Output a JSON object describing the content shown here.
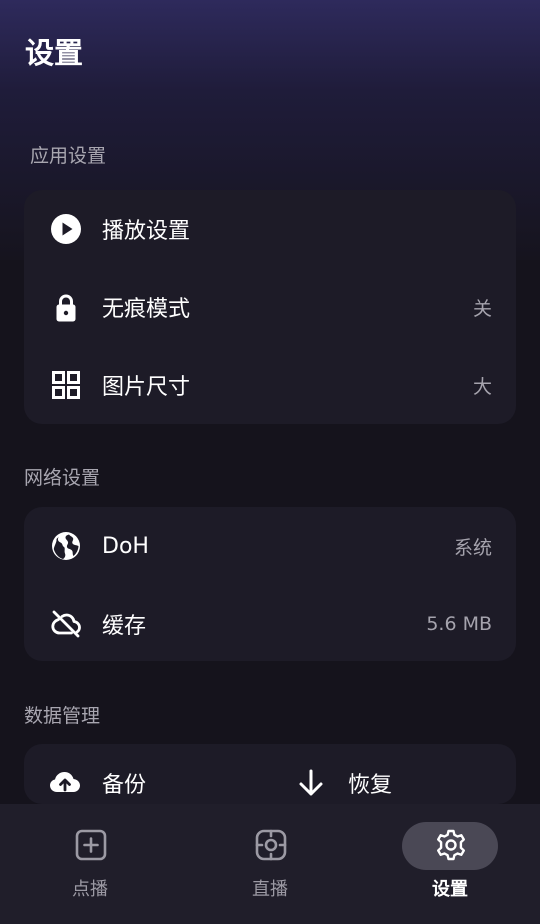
{
  "header": {
    "title": "设置"
  },
  "sections": {
    "app": {
      "label": "应用设置",
      "items": [
        {
          "label": "播放设置",
          "value": "",
          "icon": "play-circle-icon"
        },
        {
          "label": "无痕模式",
          "value": "关",
          "icon": "lock-icon"
        },
        {
          "label": "图片尺寸",
          "value": "大",
          "icon": "grid-icon"
        }
      ]
    },
    "network": {
      "label": "网络设置",
      "items": [
        {
          "label": "DoH",
          "value": "系统",
          "icon": "globe-icon"
        },
        {
          "label": "缓存",
          "value": "5.6 MB",
          "icon": "cloud-off-icon"
        }
      ]
    },
    "data": {
      "label": "数据管理",
      "items": [
        {
          "label": "备份",
          "icon": "cloud-upload-icon"
        },
        {
          "label": "恢复",
          "icon": "arrow-down-icon"
        }
      ]
    }
  },
  "bottom_nav": {
    "items": [
      {
        "label": "点播",
        "icon": "plus-square-icon",
        "active": false
      },
      {
        "label": "直播",
        "icon": "live-target-icon",
        "active": false
      },
      {
        "label": "设置",
        "icon": "gear-icon",
        "active": true
      }
    ]
  },
  "colors": {
    "background": "#15131c",
    "card": "#1d1b27",
    "nav_active_pill": "#4a4855",
    "secondary_text": "#a8a6b0"
  }
}
